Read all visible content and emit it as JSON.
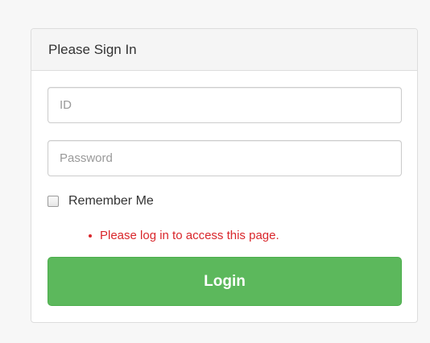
{
  "panel": {
    "title": "Please Sign In"
  },
  "form": {
    "id_field": {
      "placeholder": "ID",
      "value": ""
    },
    "password_field": {
      "placeholder": "Password",
      "value": ""
    },
    "remember_me": {
      "label": "Remember Me",
      "checked": false
    },
    "errors": [
      "Please log in to access this page."
    ],
    "login_label": "Login"
  },
  "colors": {
    "background": "#f7f7f7",
    "panel_heading": "#f5f5f5",
    "error": "#d9262b",
    "login_button": "#5cb85c"
  }
}
